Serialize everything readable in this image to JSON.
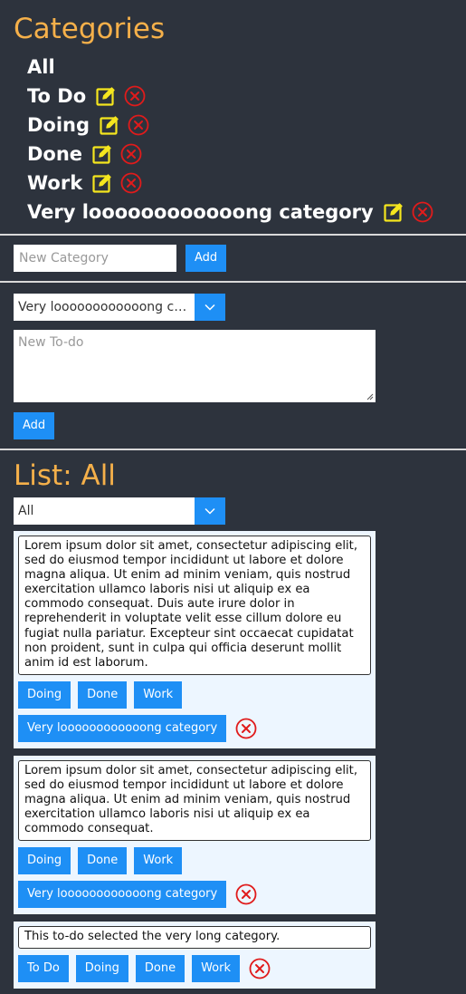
{
  "categories_section": {
    "title": "Categories",
    "items": [
      {
        "label": "All",
        "editable": false
      },
      {
        "label": "To Do",
        "editable": true
      },
      {
        "label": "Doing",
        "editable": true
      },
      {
        "label": "Done",
        "editable": true
      },
      {
        "label": "Work",
        "editable": true
      },
      {
        "label": "Very loooooooooooong category",
        "editable": true
      }
    ],
    "new_category_placeholder": "New Category",
    "add_label": "Add"
  },
  "new_todo": {
    "category_selected": "Very loooooooooooong category",
    "placeholder": "New To-do",
    "add_label": "Add"
  },
  "list_section": {
    "title": "List: All",
    "filter_selected": "All",
    "todos": [
      {
        "text": "Lorem ipsum dolor sit amet, consectetur adipiscing elit, sed do eiusmod tempor incididunt ut labore et dolore magna aliqua. Ut enim ad minim veniam, quis nostrud exercitation ullamco laboris nisi ut aliquip ex ea commodo consequat. Duis aute irure dolor in reprehenderit in voluptate velit esse cillum dolore eu fugiat nulla pariatur. Excepteur sint occaecat cupidatat non proident, sunt in culpa qui officia deserunt mollit anim id est laborum.",
        "tags": [
          "Doing",
          "Done",
          "Work",
          "Very loooooooooooong category"
        ]
      },
      {
        "text": "Lorem ipsum dolor sit amet, consectetur adipiscing elit, sed do eiusmod tempor incididunt ut labore et dolore magna aliqua. Ut enim ad minim veniam, quis nostrud exercitation ullamco laboris nisi ut aliquip ex ea commodo consequat.",
        "tags": [
          "Doing",
          "Done",
          "Work",
          "Very loooooooooooong category"
        ]
      },
      {
        "text": "This to-do selected the very long category.",
        "tags": [
          "To Do",
          "Doing",
          "Done",
          "Work"
        ]
      }
    ]
  },
  "colors": {
    "background": "#2d333d",
    "heading": "#f5b04a",
    "accent": "#1e8ff5",
    "edit_icon": "#f5e61e",
    "delete_icon": "#e01b1b",
    "card_bg": "#edf6ff"
  },
  "icons": {
    "edit": "pencil-square-icon",
    "delete": "circle-x-icon",
    "dropdown": "chevron-down-icon",
    "resize": "resize-grip-icon"
  }
}
